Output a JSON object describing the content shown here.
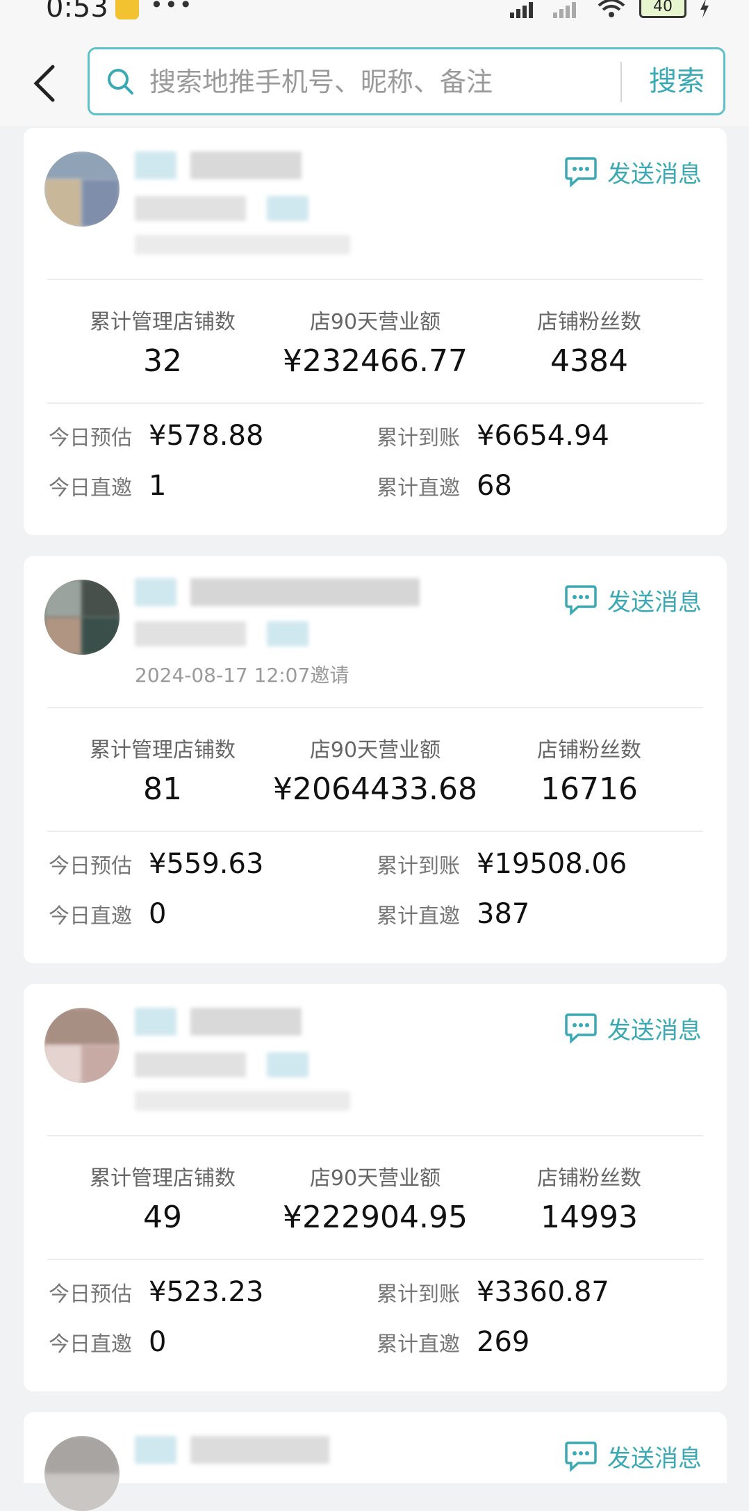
{
  "status_bar": {
    "time": "0:53",
    "dots": "•••",
    "battery": "40"
  },
  "header": {
    "search": {
      "placeholder": "搜索地推手机号、昵称、备注",
      "button": "搜索"
    }
  },
  "cards": [
    {
      "send_label": "发送消息",
      "invite_time": "",
      "stats": [
        {
          "label": "累计管理店铺数",
          "value": "32"
        },
        {
          "label": "店90天营业额",
          "value": "¥232466.77"
        },
        {
          "label": "店铺粉丝数",
          "value": "4384"
        }
      ],
      "today_estimate": {
        "label": "今日预估",
        "value": "¥578.88"
      },
      "total_received": {
        "label": "累计到账",
        "value": "¥6654.94"
      },
      "today_direct": {
        "label": "今日直邀",
        "value": "1"
      },
      "total_direct": {
        "label": "累计直邀",
        "value": "68"
      }
    },
    {
      "send_label": "发送消息",
      "invite_time": "2024-08-17 12:07邀请",
      "stats": [
        {
          "label": "累计管理店铺数",
          "value": "81"
        },
        {
          "label": "店90天营业额",
          "value": "¥2064433.68"
        },
        {
          "label": "店铺粉丝数",
          "value": "16716"
        }
      ],
      "today_estimate": {
        "label": "今日预估",
        "value": "¥559.63"
      },
      "total_received": {
        "label": "累计到账",
        "value": "¥19508.06"
      },
      "today_direct": {
        "label": "今日直邀",
        "value": "0"
      },
      "total_direct": {
        "label": "累计直邀",
        "value": "387"
      }
    },
    {
      "send_label": "发送消息",
      "invite_time": "",
      "stats": [
        {
          "label": "累计管理店铺数",
          "value": "49"
        },
        {
          "label": "店90天营业额",
          "value": "¥222904.95"
        },
        {
          "label": "店铺粉丝数",
          "value": "14993"
        }
      ],
      "today_estimate": {
        "label": "今日预估",
        "value": "¥523.23"
      },
      "total_received": {
        "label": "累计到账",
        "value": "¥3360.87"
      },
      "today_direct": {
        "label": "今日直邀",
        "value": "0"
      },
      "total_direct": {
        "label": "累计直邀",
        "value": "269"
      }
    },
    {
      "send_label": "发送消息"
    }
  ],
  "colors": {
    "accent": "#3aa9b3",
    "border": "#5cc1c8",
    "background": "#f1f2f4"
  }
}
